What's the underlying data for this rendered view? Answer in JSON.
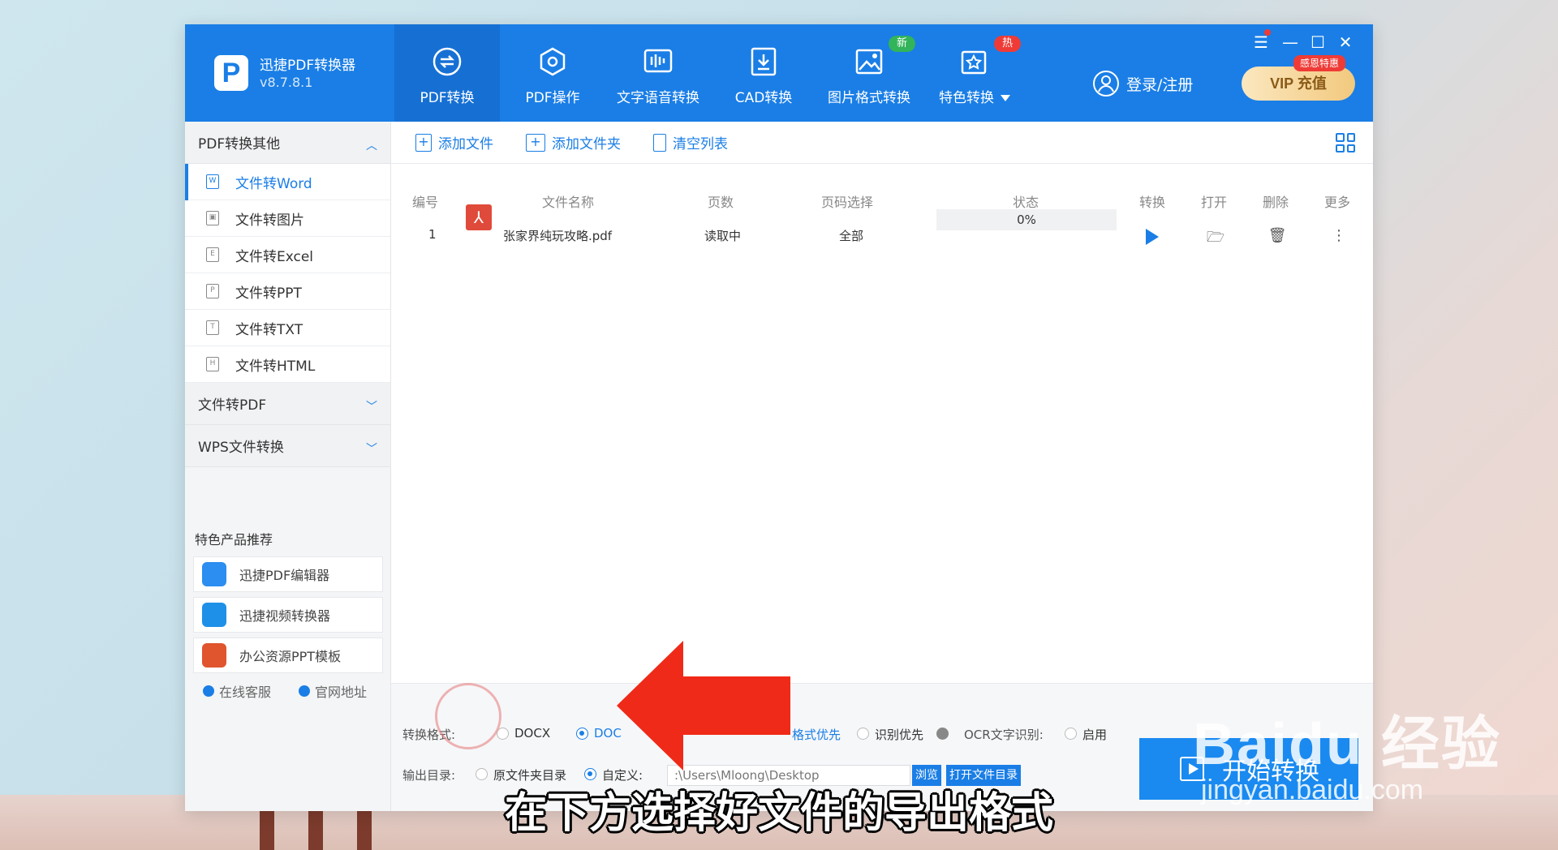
{
  "app": {
    "name": "迅捷PDF转换器",
    "version": "v8.7.8.1",
    "logo": "P"
  },
  "nav": [
    {
      "label": "PDF转换",
      "icon": "pdf-convert-icon",
      "active": true
    },
    {
      "label": "PDF操作",
      "icon": "pdf-operate-icon"
    },
    {
      "label": "文字语音转换",
      "icon": "voice-icon"
    },
    {
      "label": "CAD转换",
      "icon": "cad-icon"
    },
    {
      "label": "图片格式转换",
      "icon": "image-icon",
      "badge": "新"
    },
    {
      "label": "特色转换",
      "icon": "star-icon",
      "badge": "热"
    }
  ],
  "header": {
    "login": "登录/注册",
    "vip": "VIP 充值",
    "vip_tag": "感恩特惠"
  },
  "sidebar": {
    "group1": "PDF转换其他",
    "items": [
      {
        "label": "文件转Word",
        "icon": "W"
      },
      {
        "label": "文件转图片",
        "icon": "▣"
      },
      {
        "label": "文件转Excel",
        "icon": "E"
      },
      {
        "label": "文件转PPT",
        "icon": "P"
      },
      {
        "label": "文件转TXT",
        "icon": "T"
      },
      {
        "label": "文件转HTML",
        "icon": "H"
      }
    ],
    "group2": "文件转PDF",
    "group3": "WPS文件转换",
    "promo_title": "特色产品推荐",
    "promos": [
      "迅捷PDF编辑器",
      "迅捷视频转换器",
      "办公资源PPT模板"
    ],
    "footer": {
      "service": "在线客服",
      "website": "官网地址"
    }
  },
  "toolbar": {
    "add_file": "添加文件",
    "add_folder": "添加文件夹",
    "clear": "清空列表"
  },
  "table": {
    "headers": {
      "num": "编号",
      "name": "文件名称",
      "pages": "页数",
      "page_select": "页码选择",
      "status": "状态",
      "convert": "转换",
      "open": "打开",
      "delete": "删除",
      "more": "更多"
    },
    "rows": [
      {
        "num": "1",
        "name": "张家界纯玩攻略.pdf",
        "pages": "读取中",
        "page_select": "全部",
        "status": "0%"
      }
    ]
  },
  "bottom": {
    "format_label": "转换格式:",
    "docx": "DOCX",
    "doc": "DOC",
    "format_priority": "格式优先",
    "recognize_priority": "识别优先",
    "ocr_label": "OCR文字识别:",
    "enable": "启用",
    "output_label": "输出目录:",
    "original_dir": "原文件夹目录",
    "custom": "自定义:",
    "path": ":\\Users\\Mloong\\Desktop",
    "browse": "浏览",
    "open_dir": "打开文件目录",
    "start": "开始转换"
  },
  "caption": "在下方选择好文件的导出格式",
  "watermark": {
    "main": "Baidu 经验",
    "sub": "jingyan.baidu.com"
  },
  "colors": {
    "primary": "#1a7ee6",
    "arrow": "#f02a18"
  }
}
